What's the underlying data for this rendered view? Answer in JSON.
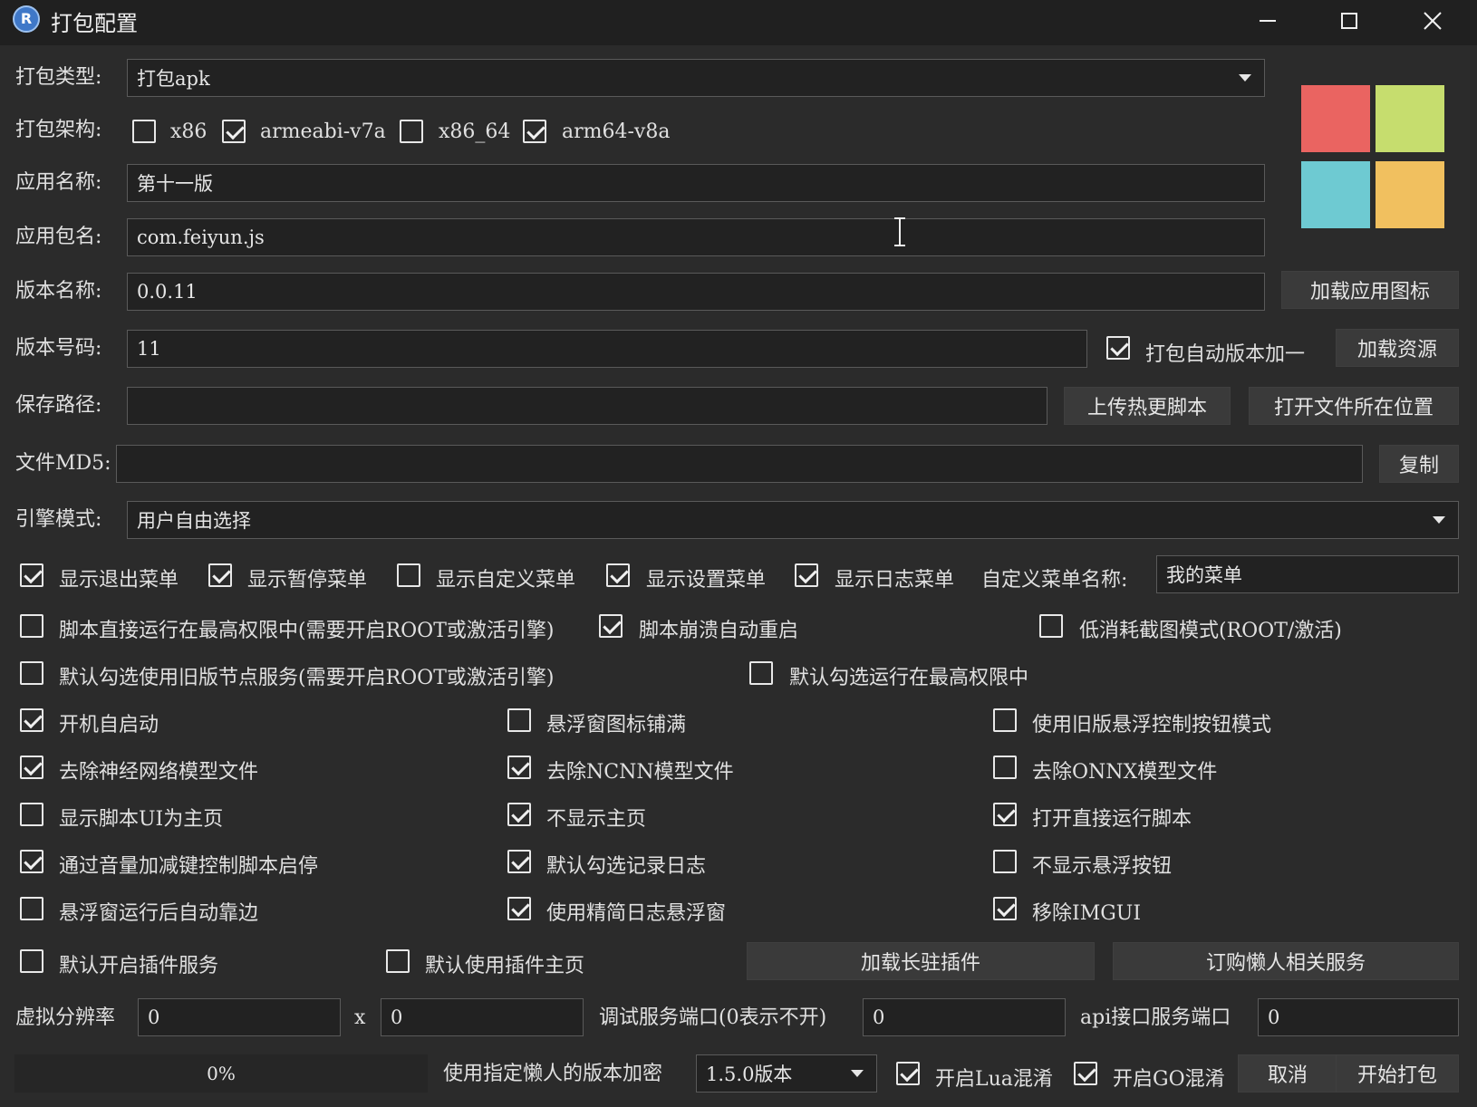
{
  "window": {
    "title": "打包配置",
    "app_icon": "lr-logo-icon",
    "controls": [
      "minimize-icon",
      "maximize-icon",
      "close-icon"
    ]
  },
  "form": {
    "pack_type": {
      "label": "打包类型:",
      "value": "打包apk"
    },
    "arch": {
      "label": "打包架构:",
      "options": [
        {
          "label": "x86",
          "checked": false
        },
        {
          "label": "armeabi-v7a",
          "checked": true
        },
        {
          "label": "x86_64",
          "checked": false
        },
        {
          "label": "arm64-v8a",
          "checked": true
        }
      ]
    },
    "app_name": {
      "label": "应用名称:",
      "value": "第十一版"
    },
    "package_name": {
      "label": "应用包名:",
      "value": "com.feiyun.js"
    },
    "version_name": {
      "label": "版本名称:",
      "value": "0.0.11"
    },
    "version_code": {
      "label": "版本号码:",
      "value": "11"
    },
    "auto_increment": {
      "label": "打包自动版本加一",
      "checked": true
    },
    "save_path": {
      "label": "保存路径:",
      "value": ""
    },
    "file_md5": {
      "label": "文件MD5:",
      "value": ""
    },
    "engine_mode": {
      "label": "引擎模式:",
      "value": "用户自由选择"
    }
  },
  "icon_colors": [
    "#ea6461",
    "#c6dd6e",
    "#6ecad2",
    "#f1c05f"
  ],
  "buttons": {
    "load_icon": "加载应用图标",
    "load_resource": "加载资源",
    "upload_hot": "上传热更脚本",
    "open_location": "打开文件所在位置",
    "copy": "复制",
    "load_plugin": "加载长驻插件",
    "order_service": "订购懒人相关服务",
    "cancel": "取消",
    "start_pack": "开始打包"
  },
  "menus_row": {
    "options": [
      {
        "label": "显示退出菜单",
        "checked": true
      },
      {
        "label": "显示暂停菜单",
        "checked": true
      },
      {
        "label": "显示自定义菜单",
        "checked": false
      },
      {
        "label": "显示设置菜单",
        "checked": true
      },
      {
        "label": "显示日志菜单",
        "checked": true
      }
    ],
    "custom_menu_label": "自定义菜单名称:",
    "custom_menu_value": "我的菜单"
  },
  "options": {
    "root_run": {
      "label": "脚本直接运行在最高权限中(需要开启ROOT或激活引擎)",
      "checked": false
    },
    "crash_restart": {
      "label": "脚本崩溃自动重启",
      "checked": true
    },
    "low_cost_shot": {
      "label": "低消耗截图模式(ROOT/激活)",
      "checked": false
    },
    "old_node": {
      "label": "默认勾选使用旧版节点服务(需要开启ROOT或激活引擎)",
      "checked": false
    },
    "default_root": {
      "label": "默认勾选运行在最高权限中",
      "checked": false
    },
    "grid": [
      [
        {
          "label": "开机自启动",
          "checked": true
        },
        {
          "label": "悬浮窗图标铺满",
          "checked": false
        },
        {
          "label": "使用旧版悬浮控制按钮模式",
          "checked": false
        }
      ],
      [
        {
          "label": "去除神经网络模型文件",
          "checked": true
        },
        {
          "label": "去除NCNN模型文件",
          "checked": true
        },
        {
          "label": "去除ONNX模型文件",
          "checked": false
        }
      ],
      [
        {
          "label": "显示脚本UI为主页",
          "checked": false
        },
        {
          "label": "不显示主页",
          "checked": true
        },
        {
          "label": "打开直接运行脚本",
          "checked": true
        }
      ],
      [
        {
          "label": "通过音量加减键控制脚本启停",
          "checked": true
        },
        {
          "label": "默认勾选记录日志",
          "checked": true
        },
        {
          "label": "不显示悬浮按钮",
          "checked": false
        }
      ],
      [
        {
          "label": "悬浮窗运行后自动靠边",
          "checked": false
        },
        {
          "label": "使用精简日志悬浮窗",
          "checked": true
        },
        {
          "label": "移除IMGUI",
          "checked": true
        }
      ]
    ],
    "plugin_service": {
      "label": "默认开启插件服务",
      "checked": false
    },
    "plugin_home": {
      "label": "默认使用插件主页",
      "checked": false
    }
  },
  "resolution": {
    "label": "虚拟分辨率",
    "x": "0",
    "sep": "x",
    "y": "0",
    "debug_label": "调试服务端口(0表示不开)",
    "debug_value": "0",
    "api_label": "api接口服务端口",
    "api_value": "0"
  },
  "footer": {
    "progress_text": "0%",
    "progress": 0,
    "encrypt_label": "使用指定懒人的版本加密",
    "encrypt_value": "1.5.0版本",
    "lua_obf": {
      "label": "开启Lua混淆",
      "checked": true
    },
    "go_obf": {
      "label": "开启GO混淆",
      "checked": true
    }
  }
}
